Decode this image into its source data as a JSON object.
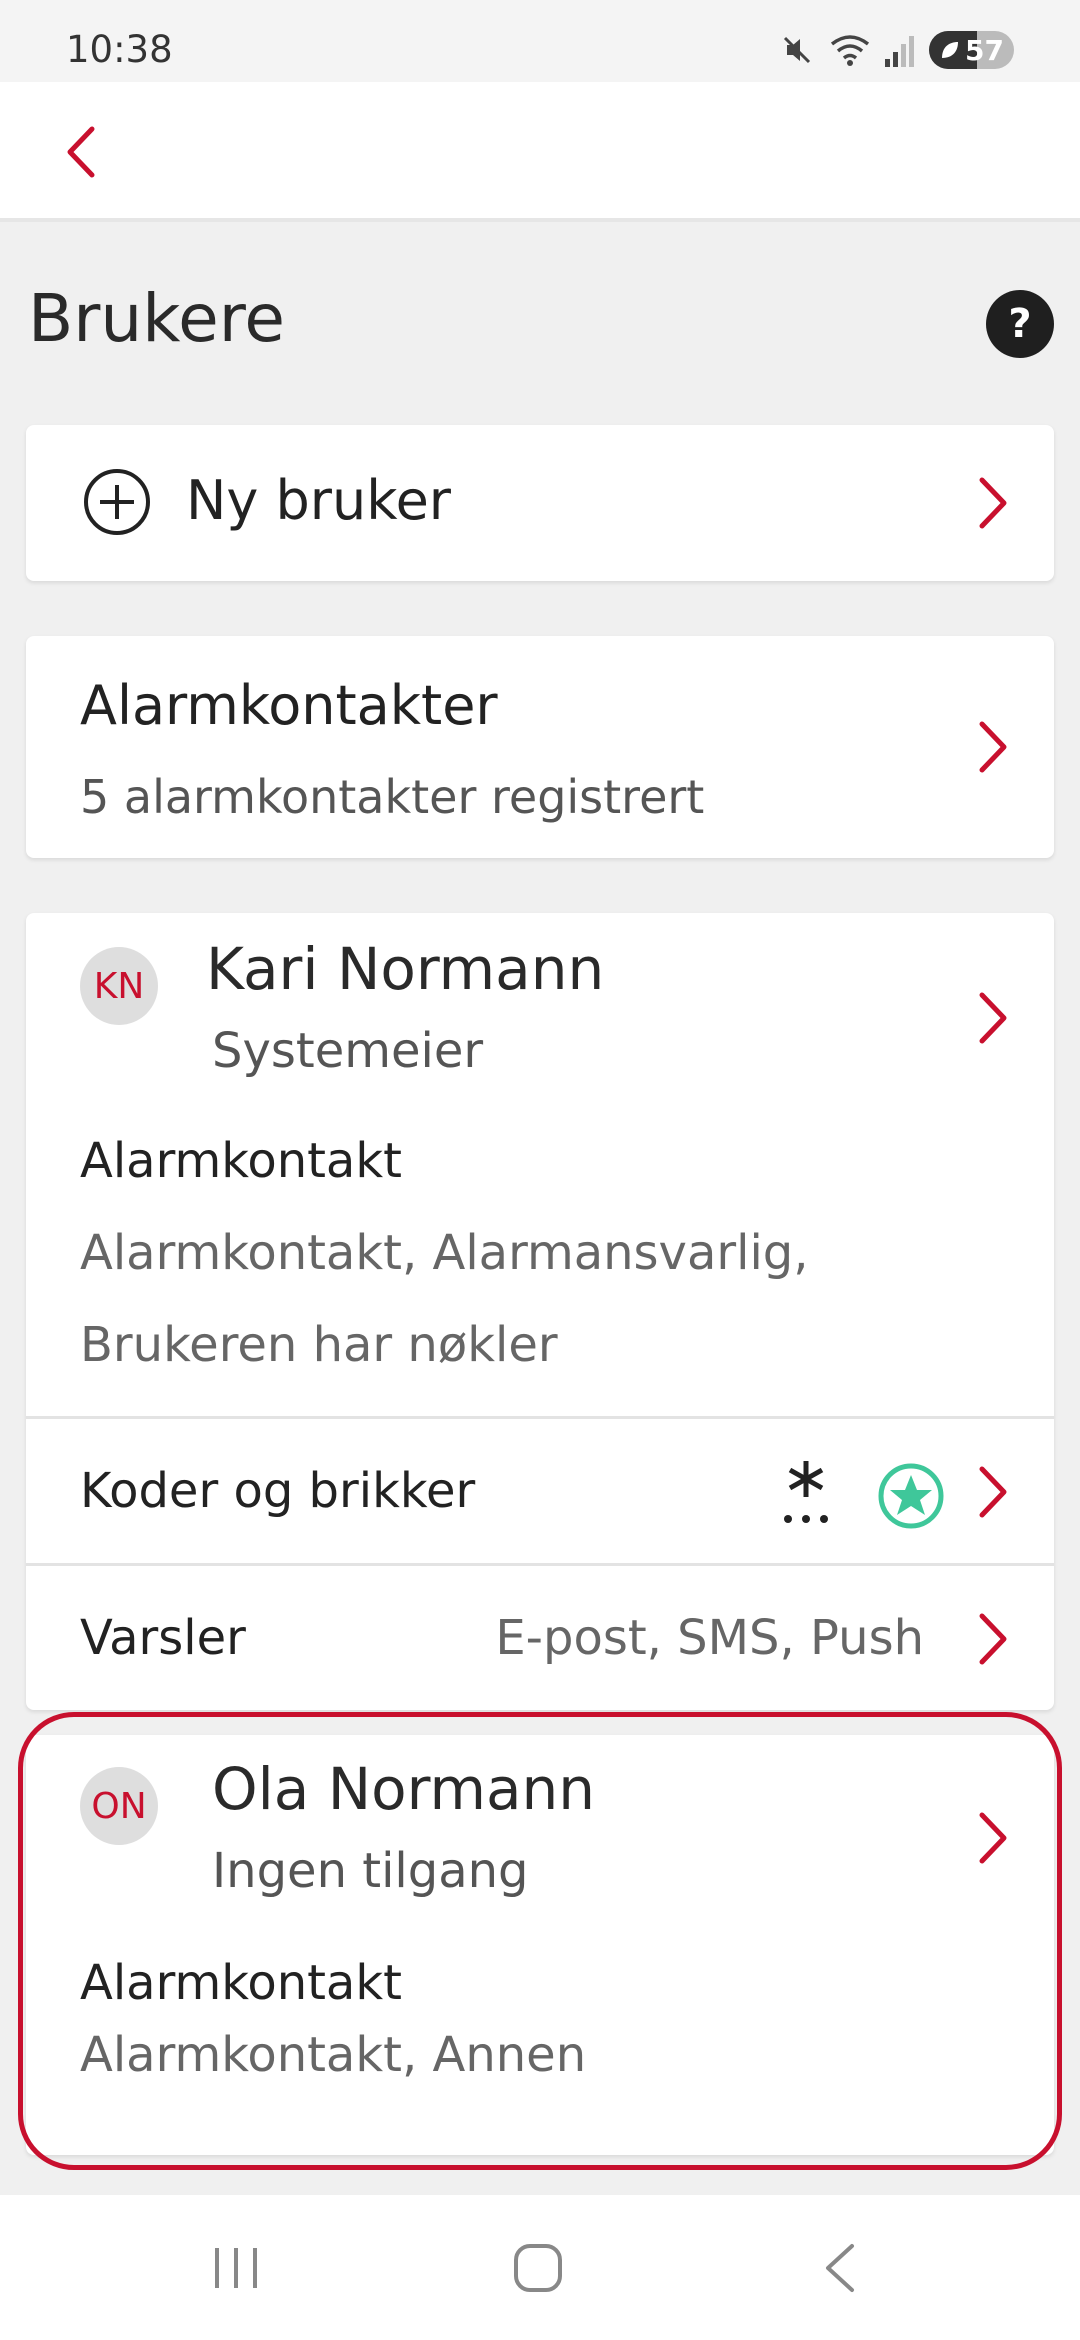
{
  "status_bar": {
    "time": "10:38",
    "battery": "57"
  },
  "page": {
    "title": "Brukere",
    "help": "?"
  },
  "new_user": {
    "label": "Ny bruker"
  },
  "alarm_contacts": {
    "title": "Alarmkontakter",
    "subtitle": "5 alarmkontakter registrert"
  },
  "users": [
    {
      "initials": "KN",
      "name": "Kari Normann",
      "role": "Systemeier",
      "contact_title": "Alarmkontakt",
      "contact_text": "Alarmkontakt, Alarmansvarlig, Brukeren har nøkler",
      "codes_label": "Koder og brikker",
      "notifications_label": "Varsler",
      "notifications_value": "E-post, SMS, Push"
    },
    {
      "initials": "ON",
      "name": "Ola Normann",
      "role": "Ingen tilgang",
      "contact_title": "Alarmkontakt",
      "contact_text": "Alarmkontakt, Annen"
    }
  ],
  "colors": {
    "accent": "#c8102e",
    "background": "#f0f0f0",
    "card": "#ffffff",
    "tag_green": "#3fc79a"
  }
}
